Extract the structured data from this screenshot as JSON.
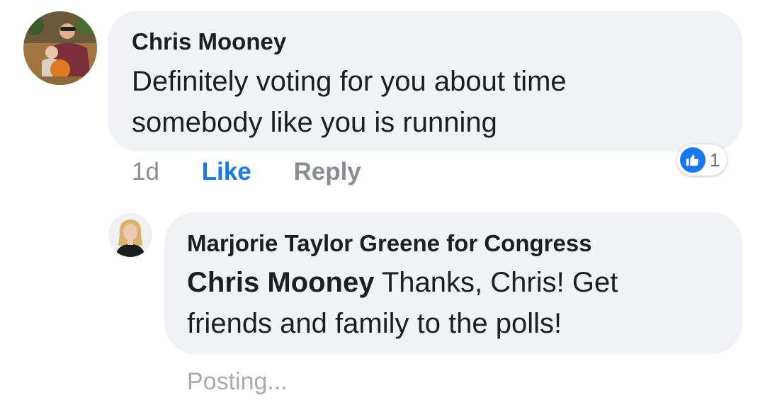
{
  "comment": {
    "author": "Chris Mooney",
    "text_line1": "Definitely voting for you about time",
    "text_line2": "somebody like you is running",
    "time": "1d",
    "like_label": "Like",
    "reply_label": "Reply",
    "reaction_icon": "thumbs-up-icon",
    "reaction_count": "1",
    "accent_color": "#1877f2"
  },
  "reply": {
    "author": "Marjorie Taylor Greene for Congress",
    "mention": "Chris Mooney",
    "text_part1": "Thanks, Chris! Get",
    "text_line2": "friends and family to the polls!",
    "status": "Posting..."
  }
}
